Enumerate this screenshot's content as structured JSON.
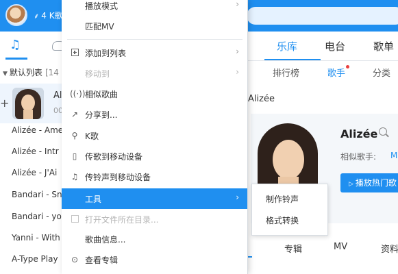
{
  "topbar": {
    "vip_text": "4 K歌",
    "feather_glyph": "⸙",
    "accent_color": "#1f8ff0"
  },
  "left_panel": {
    "playlist_header": "默认列表",
    "playlist_count": "[14",
    "now_playing": {
      "title": "Al",
      "time": "00"
    },
    "songs": [
      "Alizée - Ame",
      "Alizée - Intr",
      "Alizée - J'Ai",
      "Bandari - Sn",
      "Bandari - yo",
      "Yanni - With",
      "A-Type Play"
    ]
  },
  "right_panel": {
    "nav_tabs": [
      "乐库",
      "电台",
      "歌单"
    ],
    "sub_tabs": [
      "排行榜",
      "歌手",
      "分类"
    ],
    "breadcrumb": "Alizée",
    "artist": {
      "name": "Alizée",
      "similar_label": "相似歌手:",
      "similar_link": "M",
      "play_button": "播放热门歌"
    },
    "bottom_tabs": [
      "曲",
      "专辑",
      "MV",
      "资料"
    ]
  },
  "context_menu": {
    "items": [
      {
        "label": "播放模式",
        "icon": "",
        "arrow": true,
        "disabled": false
      },
      {
        "label": "匹配MV",
        "icon": "",
        "arrow": false,
        "disabled": false
      },
      {
        "label": "添加到列表",
        "icon": "add-box-icon",
        "arrow": true,
        "disabled": false
      },
      {
        "label": "移动到",
        "icon": "",
        "arrow": true,
        "disabled": true
      },
      {
        "label": "相似歌曲",
        "icon": "radio-waves-icon",
        "arrow": false,
        "disabled": false
      },
      {
        "label": "分享到...",
        "icon": "share-icon",
        "arrow": false,
        "disabled": false
      },
      {
        "label": "K歌",
        "icon": "microphone-icon",
        "arrow": false,
        "disabled": false
      },
      {
        "label": "传歌到移动设备",
        "icon": "phone-icon",
        "arrow": false,
        "disabled": false
      },
      {
        "label": "传铃声到移动设备",
        "icon": "bell-icon",
        "arrow": false,
        "disabled": false
      },
      {
        "label": "工具",
        "icon": "",
        "arrow": true,
        "disabled": false,
        "highlighted": true
      },
      {
        "label": "打开文件所在目录...",
        "icon": "folder-icon",
        "arrow": false,
        "disabled": true
      },
      {
        "label": "歌曲信息...",
        "icon": "",
        "arrow": false,
        "disabled": false
      },
      {
        "label": "查看专辑",
        "icon": "album-disc-icon",
        "arrow": false,
        "disabled": false
      }
    ],
    "arrow_glyph": "›"
  },
  "submenu": {
    "items": [
      "制作铃声",
      "格式转换"
    ]
  }
}
